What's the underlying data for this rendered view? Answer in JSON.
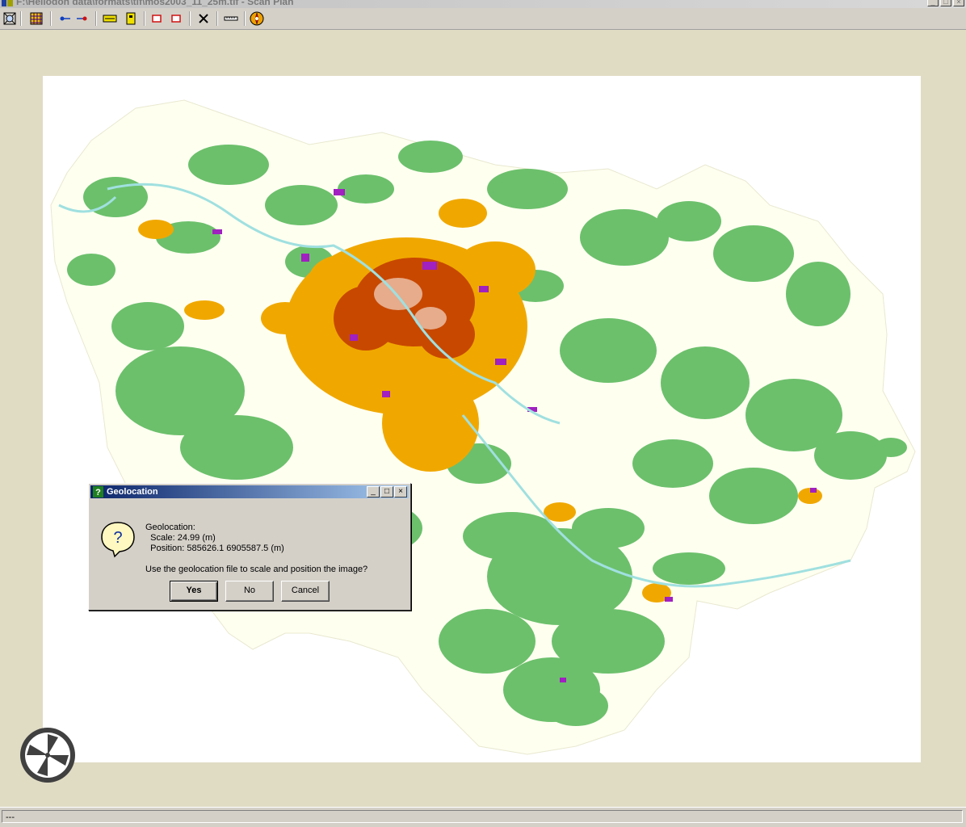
{
  "window": {
    "title": "F:\\Heliodon data\\formats\\tif\\mos2003_11_25m.tif - Scan Plan",
    "controls": [
      "minimize-icon",
      "maximize-icon",
      "close-icon"
    ]
  },
  "toolbar": {
    "tools": [
      {
        "name": "zoom-extents-tool",
        "icon": "zoom-extents-icon"
      },
      {
        "name": "grid-tool",
        "icon": "grid-icon"
      },
      {
        "name": "point-start-tool",
        "icon": "point-start-icon"
      },
      {
        "name": "point-end-tool",
        "icon": "point-end-icon"
      },
      {
        "name": "scale-bar-tool",
        "icon": "scale-bar-icon"
      },
      {
        "name": "scale-vertical-tool",
        "icon": "scale-vertical-icon"
      },
      {
        "name": "rectangle-tool",
        "icon": "rectangle-icon"
      },
      {
        "name": "rectangle-red-tool",
        "icon": "rectangle-red-icon"
      },
      {
        "name": "delete-tool",
        "icon": "close-x-icon"
      },
      {
        "name": "ruler-tool",
        "icon": "ruler-icon"
      },
      {
        "name": "compass-tool",
        "icon": "compass-icon"
      }
    ]
  },
  "map": {
    "colors": {
      "background": "#fffff0",
      "vegetation": "#6cc06c",
      "urban_orange": "#f0a800",
      "urban_dense": "#c84800",
      "industrial": "#a020c0",
      "water": "#a0e0e0"
    }
  },
  "dialog": {
    "title": "Geolocation",
    "heading": "Geolocation:",
    "scale_line": "  Scale: 24.99 (m)",
    "position_line": "  Position: 585626.1 6905587.5 (m)",
    "question": "Use the geolocation file to scale and position the image?",
    "buttons": {
      "yes": "Yes",
      "no": "No",
      "cancel": "Cancel"
    }
  },
  "statusbar": {
    "text": "---"
  }
}
